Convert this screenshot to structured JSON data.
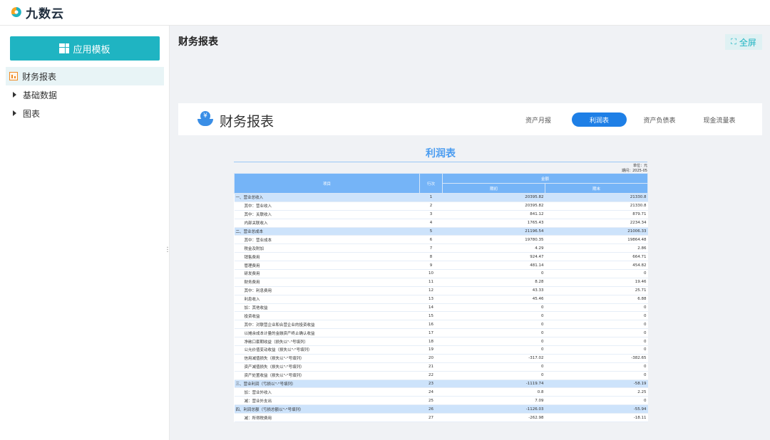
{
  "app": {
    "logo_text": "九数云"
  },
  "sidebar": {
    "app_template_label": "应用模板",
    "items": [
      {
        "label": "财务报表",
        "active": true
      },
      {
        "label": "基础数据"
      },
      {
        "label": "图表"
      }
    ]
  },
  "main": {
    "page_title": "财务报表",
    "fullscreen_label": "全屏"
  },
  "report_header": {
    "title": "财务报表",
    "tabs": [
      {
        "label": "资产月报"
      },
      {
        "label": "利润表",
        "active": true
      },
      {
        "label": "资产负债表"
      },
      {
        "label": "现金流量表"
      }
    ]
  },
  "table": {
    "title": "利润表",
    "unit": "单位：元",
    "date": "期间：2025-05",
    "headers": {
      "item": "项目",
      "line": "行次",
      "amount": "金额",
      "begin": "期初",
      "end": "期末"
    },
    "rows": [
      {
        "item": "一、营业总收入",
        "line": "1",
        "begin": "20395.82",
        "end": "21330.8",
        "section": true
      },
      {
        "item": "其中：营业收入",
        "line": "2",
        "begin": "20395.82",
        "end": "21330.8",
        "indent": true
      },
      {
        "item": "其中：关联收入",
        "line": "3",
        "begin": "841.12",
        "end": "879.71",
        "indent": true
      },
      {
        "item": "内部关联收入",
        "line": "4",
        "begin": "1765.43",
        "end": "2234.34",
        "indent": true
      },
      {
        "item": "二、营业总成本",
        "line": "5",
        "begin": "21196.54",
        "end": "21006.33",
        "section": true
      },
      {
        "item": "其中：营业成本",
        "line": "6",
        "begin": "19780.35",
        "end": "19864.48",
        "indent": true
      },
      {
        "item": "税金及附加",
        "line": "7",
        "begin": "4.29",
        "end": "2.86",
        "indent": true
      },
      {
        "item": "销售费用",
        "line": "8",
        "begin": "924.47",
        "end": "664.71",
        "indent": true
      },
      {
        "item": "管理费用",
        "line": "9",
        "begin": "481.14",
        "end": "454.82",
        "indent": true
      },
      {
        "item": "研发费用",
        "line": "10",
        "begin": "0",
        "end": "0",
        "indent": true
      },
      {
        "item": "财务费用",
        "line": "11",
        "begin": "8.28",
        "end": "19.46",
        "indent": true
      },
      {
        "item": "其中：利息费用",
        "line": "12",
        "begin": "43.33",
        "end": "25.71",
        "indent": true
      },
      {
        "item": "利息收入",
        "line": "13",
        "begin": "45.46",
        "end": "6.88",
        "indent": true
      },
      {
        "item": "加：其他收益",
        "line": "14",
        "begin": "0",
        "end": "0",
        "indent": true
      },
      {
        "item": "投资收益",
        "line": "15",
        "begin": "0",
        "end": "0",
        "indent": true
      },
      {
        "item": "其中：对联营企业和合营企业的投资收益",
        "line": "16",
        "begin": "0",
        "end": "0",
        "indent": true
      },
      {
        "item": "以摊余成本计量的金融资产终止确认收益",
        "line": "17",
        "begin": "0",
        "end": "0",
        "indent": true
      },
      {
        "item": "净敞口套期收益（损失以\"-\"号填列）",
        "line": "18",
        "begin": "0",
        "end": "0",
        "indent": true
      },
      {
        "item": "公允价值变动收益（损失以\"-\"号填列）",
        "line": "19",
        "begin": "0",
        "end": "0",
        "indent": true
      },
      {
        "item": "信用减值损失（损失以\"-\"号填列）",
        "line": "20",
        "begin": "-317.02",
        "end": "-382.65",
        "indent": true
      },
      {
        "item": "资产减值损失（损失以\"-\"号填列）",
        "line": "21",
        "begin": "0",
        "end": "0",
        "indent": true
      },
      {
        "item": "资产处置收益（损失以\"-\"号填列）",
        "line": "22",
        "begin": "0",
        "end": "0",
        "indent": true
      },
      {
        "item": "三、营业利润（亏损以\"-\"号填列）",
        "line": "23",
        "begin": "-1119.74",
        "end": "-58.19",
        "section": true
      },
      {
        "item": "加：营业外收入",
        "line": "24",
        "begin": "0.8",
        "end": "2.25",
        "indent": true
      },
      {
        "item": "减：营业外支出",
        "line": "25",
        "begin": "7.09",
        "end": "0",
        "indent": true
      },
      {
        "item": "四、利润总额（亏损总额以\"-\"号填列）",
        "line": "26",
        "begin": "-1126.03",
        "end": "-55.94",
        "section": true
      },
      {
        "item": "减：所得税费用",
        "line": "27",
        "begin": "-262.98",
        "end": "-18.11",
        "indent": true
      }
    ]
  }
}
